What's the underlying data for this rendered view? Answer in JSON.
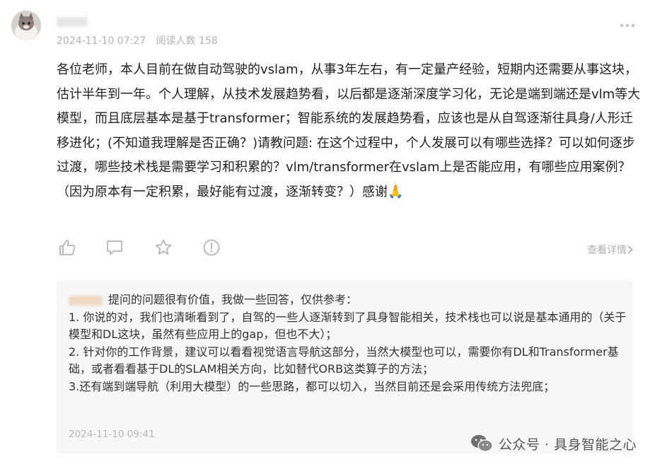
{
  "post": {
    "timestamp": "2024-11-10 07:27",
    "read_count": "阅读人数 158",
    "body": "各位老师，本人目前在做自动驾驶的vslam，从事3年左右，有一定量产经验，短期内还需要从事这块，估计半年到一年。个人理解，从技术发展趋势看，以后都是逐渐深度学习化，无论是端到端还是vlm等大模型，而且底层基本是基于transformer；智能系统的发展趋势看，应该也是从自驾逐渐往具身/人形迁移进化；(不知道我理解是否正确？)请教问题: 在这个过程中，个人发展可以有哪些选择？可以如何逐步过渡，哪些技术栈是需要学习和积累的？vlm/transformer在vslam上是否能应用，有哪些应用案例？（因为原本有一定积累，最好能有过渡，逐渐转变？）感谢🙏"
  },
  "actions": {
    "detail_label": "查看详情"
  },
  "icons": {
    "like": "thumbs-up-icon",
    "comment": "comment-icon",
    "favorite": "star-icon",
    "report": "alert-icon",
    "more": "more-dots-icon",
    "chevron": "chevron-right-icon",
    "wechat": "wechat-icon"
  },
  "reply": {
    "intro": "提问的问题很有价值，我做一些回答，仅供参考：",
    "point1": "1. 你说的对，我们也清晰看到了，自驾的一些人逐渐转到了具身智能相关，技术栈也可以说是基本通用的（关于模型和DL这块，虽然有些应用上的gap，但也不大）；",
    "point2": "2. 针对你的工作背景，建议可以看看视觉语言导航这部分，当然大模型也可以，需要你有DL和Transformer基础，或者看看基于DL的SLAM相关方向，比如替代ORB这类算子的方法；",
    "point3": "3.还有端到端导航（利用大模型）的一些思路，都可以切入，当然目前还是会采用传统方法兜底；",
    "timestamp": "2024-11-10 09:41"
  },
  "watermark": {
    "text": "公众号 · 具身智能之心"
  }
}
